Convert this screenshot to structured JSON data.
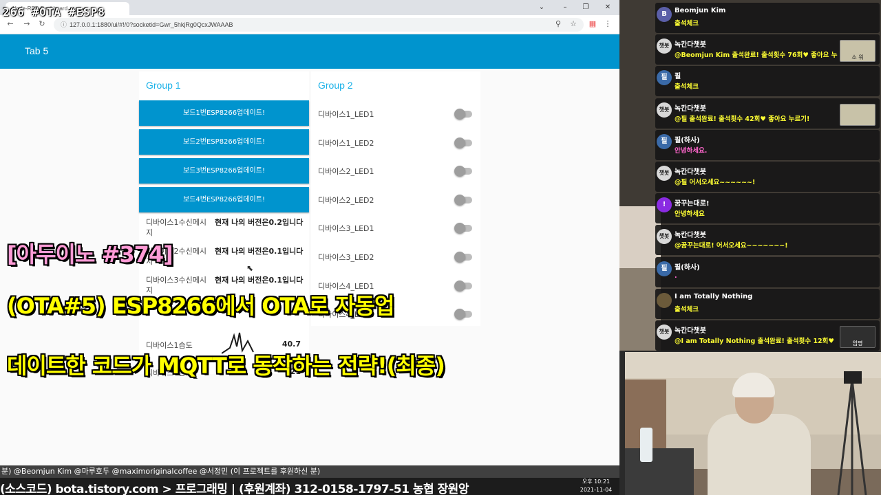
{
  "stream_tag": "266 #OTA #ESP8",
  "browser": {
    "tab_title": "Node-RED Dashboard",
    "url": "127.0.0.1:1880/ui/#!/0?socketid=Gwr_5hkjRg0QcxJWAAAB"
  },
  "dashboard": {
    "tab_title": "Tab 5",
    "group1": {
      "title": "Group 1",
      "buttons": [
        "보드1번ESP8266업데이트!",
        "보드2번ESP8266업데이트!",
        "보드3번ESP8266업데이트!",
        "보드4번ESP8266업데이트!"
      ],
      "texts": [
        {
          "label": "디바이스1수신메시지",
          "value": "현재 나의 버전은0.2입니다"
        },
        {
          "label": "디바이스2수신메시지",
          "value": "현재 나의 버전은0.1입니다"
        },
        {
          "label": "디바이스3수신메시지",
          "value": "현재 나의 버전은0.1입니다"
        }
      ],
      "gauges": [
        {
          "label": "디바이스1습도",
          "value": "40.7"
        },
        {
          "label": "디바이스1온도",
          "value": "21"
        }
      ]
    },
    "group2": {
      "title": "Group 2",
      "switches": [
        {
          "label": "디바이스1_LED1",
          "on": false
        },
        {
          "label": "디바이스1_LED2",
          "on": false
        },
        {
          "label": "디바이스2_LED1",
          "on": false
        },
        {
          "label": "디바이스2_LED2",
          "on": false
        },
        {
          "label": "디바이스3_LED1",
          "on": false
        },
        {
          "label": "디바이스3_LED2",
          "on": false
        },
        {
          "label": "디바이스4_LED1",
          "on": false
        },
        {
          "label": "디바이스4_LED2",
          "on": false
        }
      ]
    }
  },
  "headline": {
    "line1": "[아두이노 #374]",
    "line2": "(OTA#5) ESP8266에서 OTA로 자동업",
    "line3": "데이트한 코드가 MQTT로 동작하는 전략!(최종)"
  },
  "sponsor_line": "분) @Beomjun Kim @마루호두 @maximoriginalcoffee @서정민 (이 프로젝트를 후원하신 분)",
  "bottom_line": "(소스코드) bota.tistory.com > 프로그래밍 | (후원계좌) 312-0158-1797-51 농협 장원앙",
  "clock": {
    "time": "오후 10:21",
    "date": "2021-11-04"
  },
  "chat": {
    "messages": [
      {
        "avatar": "B",
        "avatar_color": "#5b5fa8",
        "name": "Beomjun Kim",
        "text": "출석체크",
        "text_color": "#ffff33",
        "sticker": null
      },
      {
        "avatar": "챗봇",
        "avatar_color": "#d8d8d8",
        "name": "녹칸다챗봇",
        "text": "@Beomjun Kim 출석완료! 출석횟수 76회♥ 좋아요 누",
        "text_color": "#ffff33",
        "sticker": "소 워"
      },
      {
        "avatar": "필",
        "avatar_color": "#3a6aa8",
        "name": "필",
        "text": "출석체크",
        "text_color": "#ffff33",
        "sticker": null
      },
      {
        "avatar": "챗봇",
        "avatar_color": "#d8d8d8",
        "name": "녹칸다챗봇",
        "text": "@필 출석완료! 출석횟수 42회♥ 좋아요 누르기!",
        "text_color": "#ffff33",
        "sticker": ""
      },
      {
        "avatar": "필",
        "avatar_color": "#3a6aa8",
        "name": "필(하사)",
        "text": "안녕하세요.",
        "text_color": "#ff66cc",
        "sticker": null
      },
      {
        "avatar": "챗봇",
        "avatar_color": "#d8d8d8",
        "name": "녹칸다챗봇",
        "text": "@필 어서오세요~~~~~~!",
        "text_color": "#ffff33",
        "sticker": null
      },
      {
        "avatar": "!",
        "avatar_color": "#8a2be2",
        "name": "꿈꾸는대로!",
        "text": "안녕하세요",
        "text_color": "#ffff33",
        "sticker": null
      },
      {
        "avatar": "챗봇",
        "avatar_color": "#d8d8d8",
        "name": "녹칸다챗봇",
        "text": "@꿈꾸는대로! 어서오세요~~~~~~~!",
        "text_color": "#ffff33",
        "sticker": null
      },
      {
        "avatar": "필",
        "avatar_color": "#3a6aa8",
        "name": "필(하사)",
        "text": ".",
        "text_color": "#ff66cc",
        "sticker": null
      },
      {
        "avatar": "",
        "avatar_color": "#6b5a3a",
        "name": "I am Totally Nothing",
        "text": "출석체크",
        "text_color": "#ffff33",
        "sticker": null
      },
      {
        "avatar": "챗봇",
        "avatar_color": "#d8d8d8",
        "name": "녹칸다챗봇",
        "text": "@I am Totally Nothing 출석완료! 출석횟수 12회♥",
        "text_color": "#ffff33",
        "sticker": "임명"
      }
    ]
  },
  "colors": {
    "node_red_blue": "#0094ce",
    "group_title": "#1ab1e8",
    "headline_yellow": "#ffff00",
    "headline_pink": "#ff9bd6"
  }
}
